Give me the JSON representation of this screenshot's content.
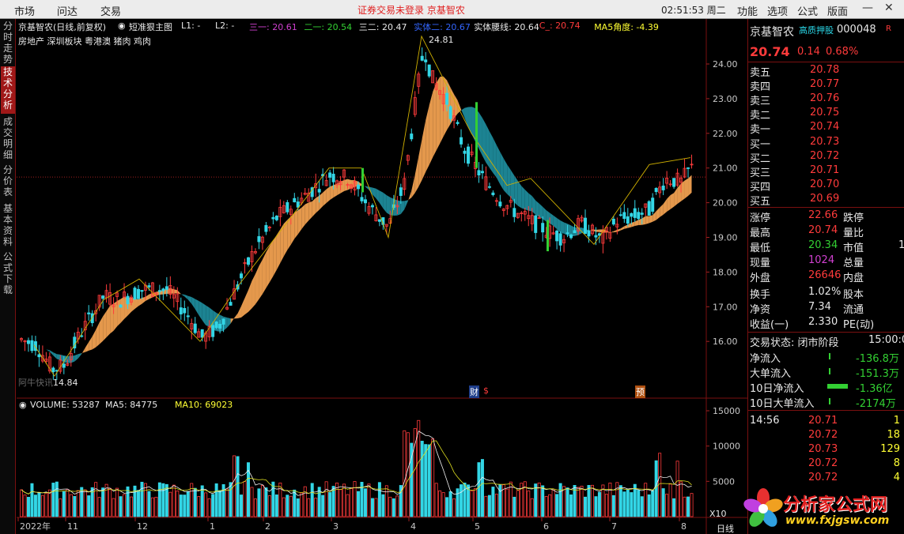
{
  "topbar": {
    "nav": [
      "市场",
      "问达",
      "交易"
    ],
    "notice": "证券交易未登录 京基智农",
    "time": "02:51:53 周二",
    "right": [
      "功能",
      "选项",
      "公式",
      "版面"
    ]
  },
  "lefttabs": [
    "分时走势",
    "技术分析",
    "成交明细",
    "分价表",
    "基本资料",
    "公式下载"
  ],
  "chart_header": {
    "title": "京基智农(日线,前复权)",
    "formula": "短准狠主图",
    "ind": [
      {
        "t": "L1: -",
        "c": "#e8e8e8"
      },
      {
        "t": "L2: -",
        "c": "#e8e8e8"
      },
      {
        "t": "三一: 20.61",
        "c": "#d040d0"
      },
      {
        "t": "二一: 20.54",
        "c": "#33d033"
      },
      {
        "t": "三二: 20.47",
        "c": "#e8e8e8"
      },
      {
        "t": "实体二: 20.67",
        "c": "#3366ff"
      },
      {
        "t": "实体腰线: 20.64",
        "c": "#e8e8e8"
      },
      {
        "t": "C_: 20.74",
        "c": "#ff3b3b"
      },
      {
        "t": "MA5角度: -4.39",
        "c": "#ffff33"
      }
    ],
    "concepts": "房地产 深圳板块 粤港澳 猪肉 鸡肉",
    "watermark": "阿牛快讯"
  },
  "price_axis": [
    "24.00",
    "23.00",
    "22.00",
    "21.00",
    "20.00",
    "19.00",
    "18.00",
    "17.00",
    "16.00"
  ],
  "annot": {
    "high": "24.81",
    "low": "14.84",
    "cai": "财",
    "yu": "预",
    "dollar": "$"
  },
  "volume_header": {
    "vol": "VOLUME: 53287",
    "ma5": "MA5: 84775",
    "ma10": "MA10: 69023"
  },
  "vol_axis": [
    "15000",
    "10000",
    "5000"
  ],
  "vol_mult": "X10",
  "date_axis": [
    "2022年",
    "11",
    "12",
    "1",
    "2",
    "3",
    "4",
    "5",
    "6",
    "7",
    "8"
  ],
  "period": "日线",
  "quote": {
    "name": "京基智农",
    "tag": "高质押股",
    "code": "000048",
    "price": "20.74",
    "chg": "0.14",
    "pct": "0.68%",
    "r_tag": "R"
  },
  "asks": [
    [
      "卖五",
      "20.78"
    ],
    [
      "卖四",
      "20.77"
    ],
    [
      "卖三",
      "20.76"
    ],
    [
      "卖二",
      "20.75"
    ],
    [
      "卖一",
      "20.74"
    ]
  ],
  "bids": [
    [
      "买一",
      "20.73"
    ],
    [
      "买二",
      "20.72"
    ],
    [
      "买三",
      "20.71"
    ],
    [
      "买四",
      "20.70"
    ],
    [
      "买五",
      "20.69"
    ]
  ],
  "stats": [
    {
      "l": "涨停",
      "v": "22.66",
      "c": "#ff3b3b",
      "l2": "跌停"
    },
    {
      "l": "最高",
      "v": "20.74",
      "c": "#ff3b3b",
      "l2": "量比"
    },
    {
      "l": "最低",
      "v": "20.34",
      "c": "#33d033",
      "l2": "市值",
      "v2": "1"
    },
    {
      "l": "现量",
      "v": "1024",
      "c": "#d040d0",
      "l2": "总量"
    },
    {
      "l": "外盘",
      "v": "26646",
      "c": "#ff3b3b",
      "l2": "内盘"
    }
  ],
  "stats2": [
    {
      "l": "换手",
      "v": "1.02%",
      "l2": "股本"
    },
    {
      "l": "净资",
      "v": "7.34",
      "l2": "流通"
    },
    {
      "l": "收益(一)",
      "v": "2.330",
      "l2": "PE(动)"
    }
  ],
  "trade_state": {
    "label": "交易状态: 闭市阶段",
    "time": "15:00:0"
  },
  "flows": [
    [
      "净流入",
      "-136.8万"
    ],
    [
      "大单流入",
      "-151.3万"
    ],
    [
      "10日净流入",
      "-1.36亿"
    ],
    [
      "10日大单流入",
      "-2174万"
    ]
  ],
  "ticks": [
    [
      "14:56",
      "20.71",
      "1"
    ],
    [
      "",
      "20.72",
      "18"
    ],
    [
      "",
      "20.73",
      "129"
    ],
    [
      "",
      "20.72",
      "8"
    ],
    [
      "",
      "20.72",
      "4"
    ]
  ],
  "logo": {
    "text": "分析家公式网",
    "url": "www.fxjgsw.com"
  }
}
